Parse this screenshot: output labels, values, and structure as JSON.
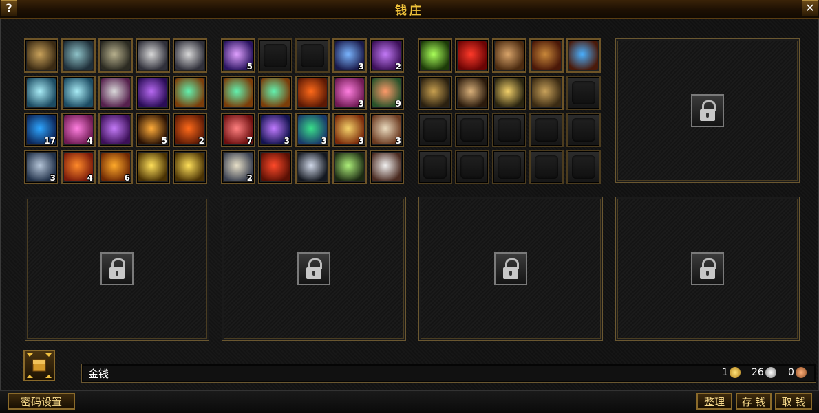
{
  "window": {
    "title": "钱庄",
    "help_icon": "help-icon",
    "close_icon": "close-icon"
  },
  "colors": {
    "title_gold": "#f1c33a",
    "panel_border": "#6a5730",
    "slot_border": "#6d5427"
  },
  "storage": {
    "panel1": [
      {
        "icon": "crossbow-icon",
        "qty": ""
      },
      {
        "icon": "magic-staff-icon",
        "qty": ""
      },
      {
        "icon": "axe-icon",
        "qty": ""
      },
      {
        "icon": "sword-icon",
        "qty": ""
      },
      {
        "icon": "sword-icon",
        "qty": ""
      },
      {
        "icon": "feather-wings-icon",
        "qty": ""
      },
      {
        "icon": "feather-wings-icon",
        "qty": ""
      },
      {
        "icon": "skull-orb-icon",
        "qty": ""
      },
      {
        "icon": "demon-mask-icon",
        "qty": ""
      },
      {
        "icon": "green-potion-icon",
        "qty": ""
      },
      {
        "icon": "blue-scroll-icon",
        "qty": "17"
      },
      {
        "icon": "pink-crystal-icon",
        "qty": "4"
      },
      {
        "icon": "purple-crystal-icon",
        "qty": ""
      },
      {
        "icon": "bomb-icon",
        "qty": "5"
      },
      {
        "icon": "fire-orb-icon",
        "qty": "2"
      },
      {
        "icon": "teapot-icon",
        "qty": "3"
      },
      {
        "icon": "fire-wing-icon",
        "qty": "4"
      },
      {
        "icon": "lantern-icon",
        "qty": "6"
      },
      {
        "icon": "golden-blade-icon",
        "qty": ""
      },
      {
        "icon": "golden-blade-icon",
        "qty": ""
      }
    ],
    "panel2": [
      {
        "icon": "spirit-orb-icon",
        "qty": "5"
      },
      {
        "icon": "empty",
        "qty": ""
      },
      {
        "icon": "empty",
        "qty": ""
      },
      {
        "icon": "blue-deer-icon",
        "qty": "3"
      },
      {
        "icon": "purple-crystal-icon",
        "qty": "2"
      },
      {
        "icon": "green-potion-icon",
        "qty": ""
      },
      {
        "icon": "green-potion-icon",
        "qty": ""
      },
      {
        "icon": "fire-orb-icon",
        "qty": ""
      },
      {
        "icon": "pink-crystal-icon",
        "qty": "3"
      },
      {
        "icon": "jade-ring-icon",
        "qty": "9"
      },
      {
        "icon": "red-ring-icon",
        "qty": "7"
      },
      {
        "icon": "purple-beads-icon",
        "qty": "3"
      },
      {
        "icon": "crystal-ball-icon",
        "qty": "3"
      },
      {
        "icon": "tent-icon",
        "qty": "3"
      },
      {
        "icon": "old-scroll-icon",
        "qty": "3"
      },
      {
        "icon": "paper-scroll-icon",
        "qty": "2"
      },
      {
        "icon": "red-scroll-icon",
        "qty": ""
      },
      {
        "icon": "spear-icon",
        "qty": ""
      },
      {
        "icon": "green-blade-icon",
        "qty": ""
      },
      {
        "icon": "fan-icon",
        "qty": ""
      }
    ],
    "panel3": [
      {
        "icon": "green-axe-icon",
        "qty": ""
      },
      {
        "icon": "red-banner-icon",
        "qty": ""
      },
      {
        "icon": "wooden-chest-icon",
        "qty": ""
      },
      {
        "icon": "money-bag-icon",
        "qty": ""
      },
      {
        "icon": "blue-flower-icon",
        "qty": ""
      },
      {
        "icon": "bow-icon",
        "qty": ""
      },
      {
        "icon": "war-horse-icon",
        "qty": ""
      },
      {
        "icon": "golden-sword-icon",
        "qty": ""
      },
      {
        "icon": "crossbow-icon",
        "qty": ""
      },
      {
        "icon": "empty",
        "qty": ""
      },
      {
        "icon": "empty",
        "qty": ""
      },
      {
        "icon": "empty",
        "qty": ""
      },
      {
        "icon": "empty",
        "qty": ""
      },
      {
        "icon": "empty",
        "qty": ""
      },
      {
        "icon": "empty",
        "qty": ""
      },
      {
        "icon": "empty",
        "qty": ""
      },
      {
        "icon": "empty",
        "qty": ""
      },
      {
        "icon": "empty",
        "qty": ""
      },
      {
        "icon": "empty",
        "qty": ""
      },
      {
        "icon": "empty",
        "qty": ""
      }
    ]
  },
  "locked_panels": [
    "lock-icon",
    "lock-icon",
    "lock-icon",
    "lock-icon",
    "lock-icon"
  ],
  "currency": {
    "label": "金钱",
    "gold": "1",
    "silver": "26",
    "copper": "0"
  },
  "buttons": {
    "password_settings": "密码设置",
    "sort": "整理",
    "deposit": "存 钱",
    "withdraw": "取 钱"
  }
}
